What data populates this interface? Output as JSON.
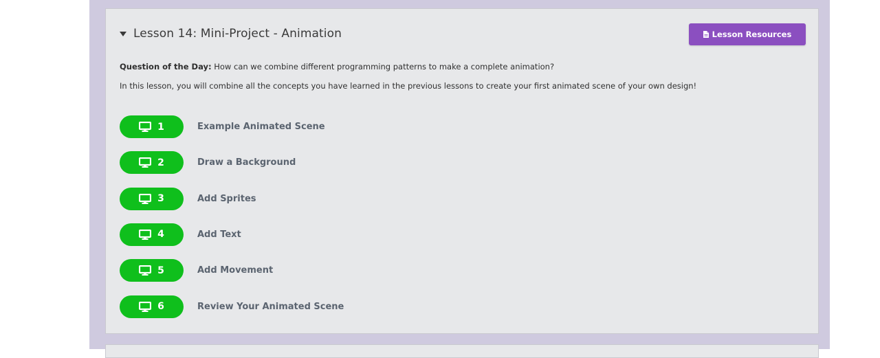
{
  "lesson": {
    "title": "Lesson 14: Mini-Project - Animation",
    "resources_label": "Lesson Resources",
    "question_label": "Question of the Day:",
    "question_text": " How can we combine different programming patterns to make a complete animation?",
    "description": "In this lesson, you will combine all the concepts you have learned in the previous lessons to create your first animated scene of your own design!",
    "levels": [
      {
        "number": "1",
        "label": "Example Animated Scene"
      },
      {
        "number": "2",
        "label": "Draw a Background"
      },
      {
        "number": "3",
        "label": "Add Sprites"
      },
      {
        "number": "4",
        "label": "Add Text"
      },
      {
        "number": "5",
        "label": "Add Movement"
      },
      {
        "number": "6",
        "label": "Review Your Animated Scene"
      }
    ]
  },
  "colors": {
    "frame": "#cfcadf",
    "card": "#e7e8ea",
    "resources_button": "#8b4fc0",
    "level_pill": "#0fbf1c",
    "level_label": "#5b6470"
  },
  "icons": {
    "toggle": "caret-down-icon",
    "resources": "document-icon",
    "level": "monitor-icon"
  }
}
